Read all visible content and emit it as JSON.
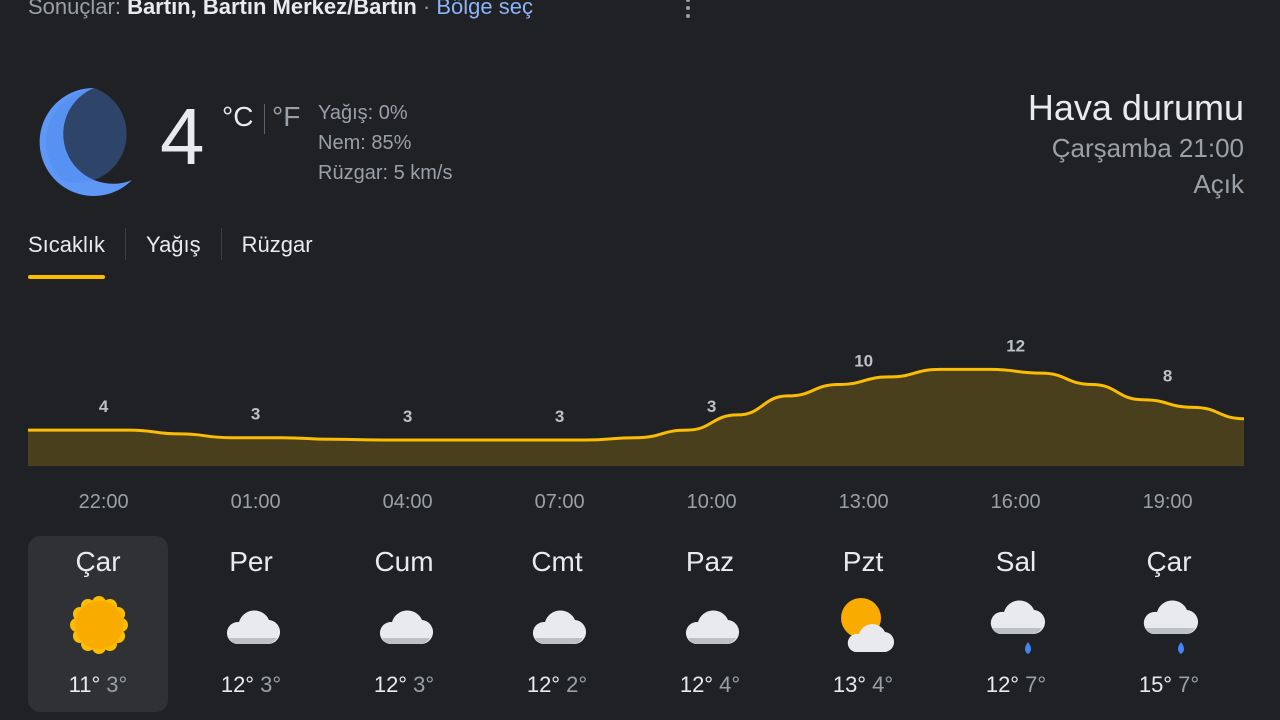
{
  "header": {
    "prefix": "Sonuçlar: ",
    "location": "Bartın, Bartın Merkez/Bartın",
    "separator": " · ",
    "region_link": "Bölge seç"
  },
  "current": {
    "condition_icon": "moon-icon",
    "temperature": "4",
    "unit_c": "°C",
    "unit_f": "°F",
    "precip": "Yağış: 0%",
    "humidity": "Nem: 85%",
    "wind": "Rüzgar: 5 km/s"
  },
  "summary": {
    "title": "Hava durumu",
    "time": "Çarşamba 21:00",
    "condition": "Açık"
  },
  "tabs": [
    {
      "label": "Sıcaklık",
      "active": true
    },
    {
      "label": "Yağış",
      "active": false
    },
    {
      "label": "Rüzgar",
      "active": false
    }
  ],
  "chart_data": {
    "type": "area",
    "x": [
      "21:00",
      "22:00",
      "23:00",
      "00:00",
      "01:00",
      "02:00",
      "03:00",
      "04:00",
      "05:00",
      "06:00",
      "07:00",
      "08:00",
      "09:00",
      "10:00",
      "11:00",
      "12:00",
      "13:00",
      "14:00",
      "15:00",
      "16:00",
      "17:00",
      "18:00",
      "19:00",
      "20:00",
      "21:00"
    ],
    "values": [
      4,
      4,
      4,
      3.5,
      3,
      3,
      2.8,
      2.7,
      2.7,
      2.7,
      2.7,
      2.7,
      3,
      4,
      6,
      8.5,
      10,
      11,
      12,
      12,
      11.5,
      10,
      8,
      7,
      5.5
    ],
    "data_labels": [
      {
        "x": "22:00",
        "label": "4"
      },
      {
        "x": "01:00",
        "label": "3"
      },
      {
        "x": "04:00",
        "label": "3"
      },
      {
        "x": "07:00",
        "label": "3"
      },
      {
        "x": "10:00",
        "label": "3"
      },
      {
        "x": "13:00",
        "label": "10"
      },
      {
        "x": "16:00",
        "label": "12"
      },
      {
        "x": "19:00",
        "label": "8"
      }
    ],
    "tick_labels": [
      "22:00",
      "01:00",
      "04:00",
      "07:00",
      "10:00",
      "13:00",
      "16:00",
      "19:00"
    ],
    "line_color": "#fbbc04",
    "fill_color": "#4a3f1d"
  },
  "days": [
    {
      "name": "Çar",
      "icon": "sun-icon",
      "high": "11°",
      "low": "3°",
      "selected": true
    },
    {
      "name": "Per",
      "icon": "cloud-icon",
      "high": "12°",
      "low": "3°",
      "selected": false
    },
    {
      "name": "Cum",
      "icon": "cloud-icon",
      "high": "12°",
      "low": "3°",
      "selected": false
    },
    {
      "name": "Cmt",
      "icon": "cloud-icon",
      "high": "12°",
      "low": "2°",
      "selected": false
    },
    {
      "name": "Paz",
      "icon": "cloud-icon",
      "high": "12°",
      "low": "4°",
      "selected": false
    },
    {
      "name": "Pzt",
      "icon": "partly-cloudy-icon",
      "high": "13°",
      "low": "4°",
      "selected": false
    },
    {
      "name": "Sal",
      "icon": "rain-cloud-icon",
      "high": "12°",
      "low": "7°",
      "selected": false
    },
    {
      "name": "Çar",
      "icon": "rain-cloud-icon",
      "high": "15°",
      "low": "7°",
      "selected": false
    }
  ]
}
